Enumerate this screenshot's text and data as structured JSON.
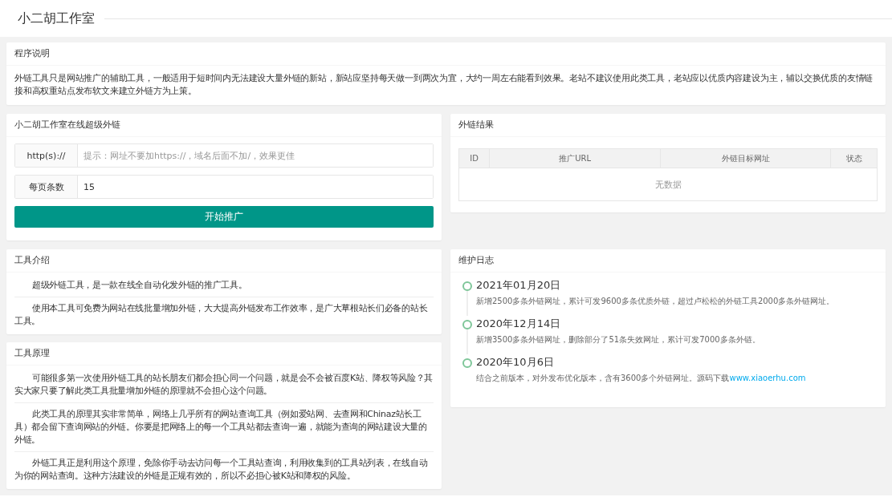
{
  "header": {
    "title": "小二胡工作室"
  },
  "program_note": {
    "title": "程序说明",
    "text": "外链工具只是网站推广的辅助工具，一般适用于短时间内无法建设大量外链的新站，新站应坚持每天做一到两次为宜，大约一周左右能看到效果。老站不建议使用此类工具，老站应以优质内容建设为主，辅以交换优质的友情链接和高权重站点发布软文来建立外链方为上策。"
  },
  "form": {
    "title": "小二胡工作室在线超级外链",
    "fields": [
      {
        "label": "http(s)://",
        "placeholder": "提示：网址不要加https://，域名后面不加/，效果更佳"
      },
      {
        "label": "每页条数",
        "value": "15"
      }
    ],
    "button": "开始推广"
  },
  "results": {
    "title": "外链结果",
    "columns": [
      "ID",
      "推广URL",
      "外链目标网址",
      "状态"
    ],
    "empty": "无数据"
  },
  "intro": {
    "title": "工具介绍",
    "paragraphs": [
      "超级外链工具，是一款在线全自动化发外链的推广工具。",
      "使用本工具可免费为网站在线批量增加外链，大大提高外链发布工作效率，是广大草根站长们必备的站长工具。"
    ]
  },
  "principle": {
    "title": "工具原理",
    "paragraphs": [
      "可能很多第一次使用外链工具的站长朋友们都会担心同一个问题，就是会不会被百度K站、降权等风险？其实大家只要了解此类工具批量增加外链的原理就不会担心这个问题。",
      "此类工具的原理其实非常简单，网络上几乎所有的网站查询工具（例如爱站网、去查网和Chinaz站长工具）都会留下查询网站的外链。你要是把网络上的每一个工具站都去查询一遍，就能为查询的网站建设大量的外链。",
      "外链工具正是利用这个原理，免除你手动去访问每一个工具站查询，利用收集到的工具站列表，在线自动为你的网站查询。这种方法建设的外链是正规有效的，所以不必担心被K站和降权的风险。"
    ]
  },
  "log": {
    "title": "维护日志",
    "entries": [
      {
        "date": "2021年01月20日",
        "text": "新增2500多条外链网址，累计可发9600多条优质外链，超过卢松松的外链工具2000多条外链网址。"
      },
      {
        "date": "2020年12月14日",
        "text": "新增3500多条外链网址，删除部分了51条失效网址，累计可发7000多条外链。"
      },
      {
        "date": "2020年10月6日",
        "text": "结合之前版本，对外发布优化版本，含有3600多个外链网址。源码下载",
        "link": "www.xiaoerhu.com"
      }
    ]
  }
}
